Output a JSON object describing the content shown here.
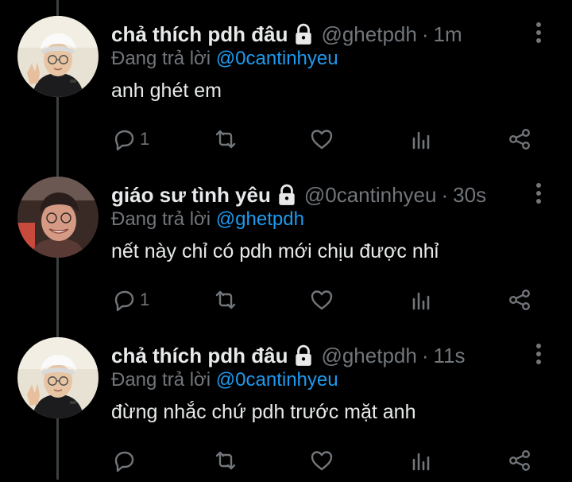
{
  "tweets": [
    {
      "display_name": "chả thích pdh đâu",
      "handle": "@ghetpdh",
      "time": "1m",
      "replying_prefix": "Đang trả lời",
      "replying_to": "@0cantinhyeu",
      "text": "anh ghét em",
      "reply_count": "1",
      "avatar": "white-cap-boy"
    },
    {
      "display_name": "giáo sư tình yêu",
      "handle": "@0cantinhyeu",
      "time": "30s",
      "replying_prefix": "Đang trả lời",
      "replying_to": "@ghetpdh",
      "text": "nết này chỉ có pdh mới chịu được nhỉ",
      "reply_count": "1",
      "avatar": "smiling-boy"
    },
    {
      "display_name": "chả thích pdh đâu",
      "handle": "@ghetpdh",
      "time": "11s",
      "replying_prefix": "Đang trả lời",
      "replying_to": "@0cantinhyeu",
      "text": "đừng nhắc chứ pdh trước mặt anh",
      "reply_count": "",
      "avatar": "white-cap-boy"
    }
  ],
  "colors": {
    "background": "#000000",
    "text": "#e7e9ea",
    "muted": "#71767b",
    "mention": "#1d9bf0",
    "thread_line": "#3c4043"
  },
  "icons": [
    "lock-icon",
    "more-vertical-icon",
    "reply-icon",
    "retweet-icon",
    "like-icon",
    "analytics-icon",
    "share-icon"
  ]
}
